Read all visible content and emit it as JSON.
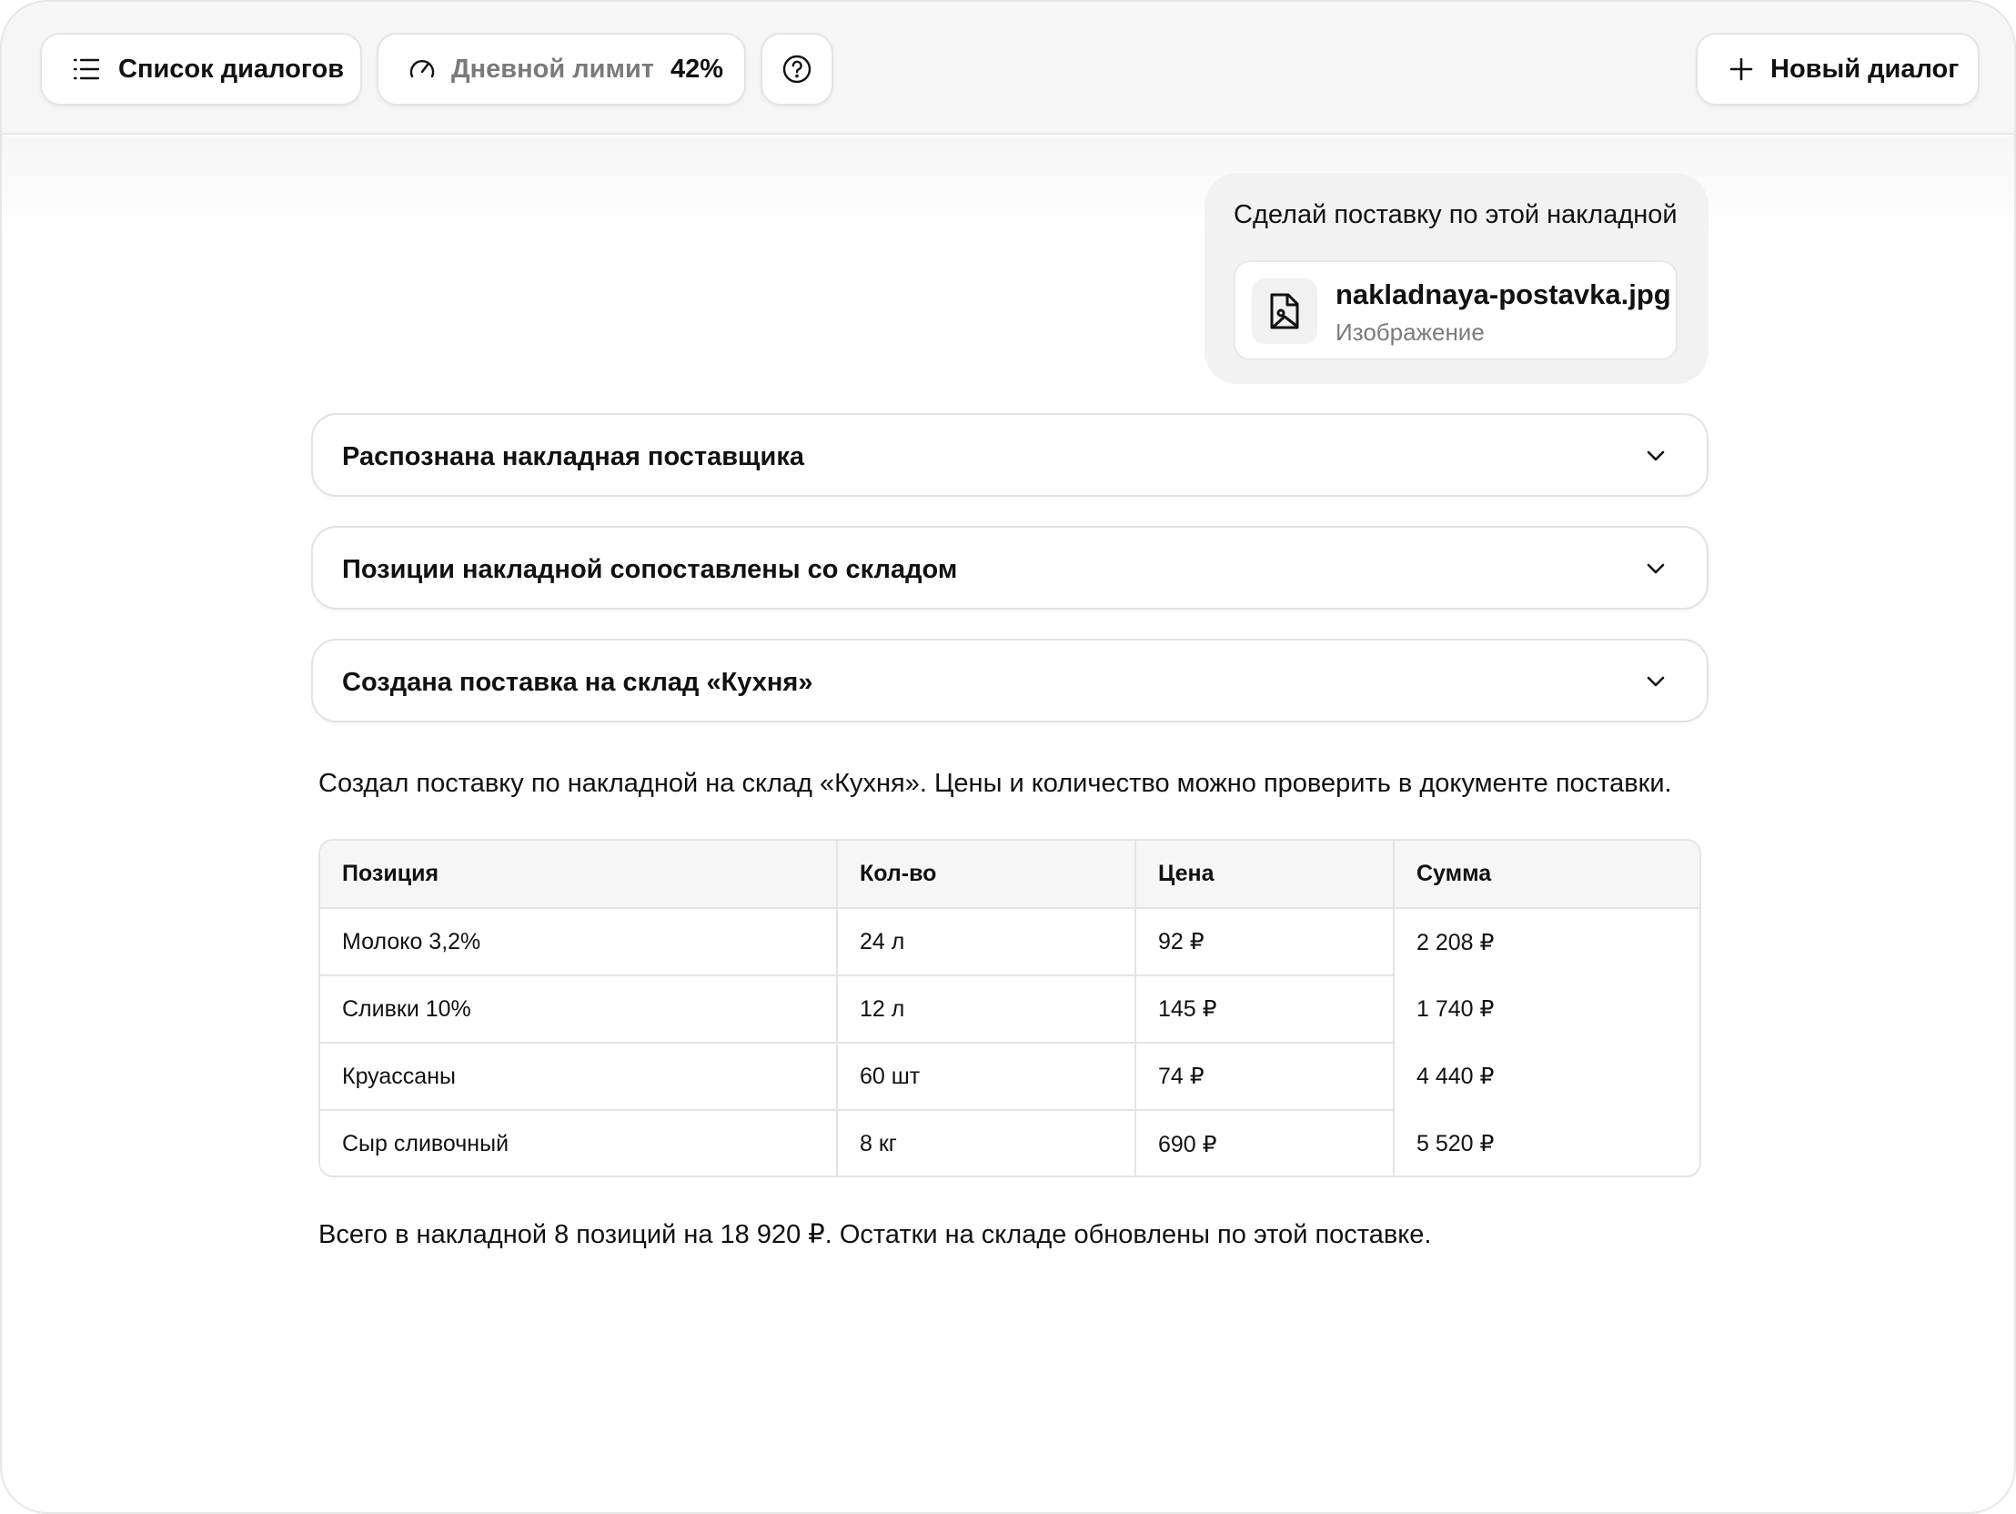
{
  "header": {
    "dialogs_label": "Список диалогов",
    "limit_label": "Дневной лимит",
    "limit_value": "42%",
    "new_dialog_label": "Новый диалог"
  },
  "user_message": {
    "text": "Сделай поставку по этой накладной",
    "attachment": {
      "name": "nakladnaya-postavka.jpg",
      "type": "Изображение"
    }
  },
  "steps": [
    {
      "title": "Распознана накладная поставщика"
    },
    {
      "title": "Позиции накладной сопоставлены со складом"
    },
    {
      "title": "Создана поставка на склад «Кухня»"
    }
  ],
  "assistant": {
    "intro": "Создал поставку по накладной на склад «Кухня». Цены и количество можно проверить в документе поставки.",
    "summary": "Всего в накладной 8 позиций на 18 920 ₽. Остатки на складе обновлены по этой поставке."
  },
  "table": {
    "headers": [
      "Позиция",
      "Кол-во",
      "Цена",
      "Сумма"
    ],
    "rows": [
      [
        "Молоко 3,2%",
        "24 л",
        "92 ₽",
        "2 208 ₽"
      ],
      [
        "Сливки 10%",
        "12 л",
        "145 ₽",
        "1 740 ₽"
      ],
      [
        "Круассаны",
        "60 шт",
        "74 ₽",
        "4 440 ₽"
      ],
      [
        "Сыр сливочный",
        "8 кг",
        "690 ₽",
        "5 520 ₽"
      ]
    ]
  },
  "icons": {
    "dialogs": "list-icon",
    "limit": "gauge-icon",
    "help": "help-circle-icon",
    "new_dialog": "plus-icon",
    "attachment": "image-file-icon",
    "step_toggle": "chevron-down-icon"
  }
}
